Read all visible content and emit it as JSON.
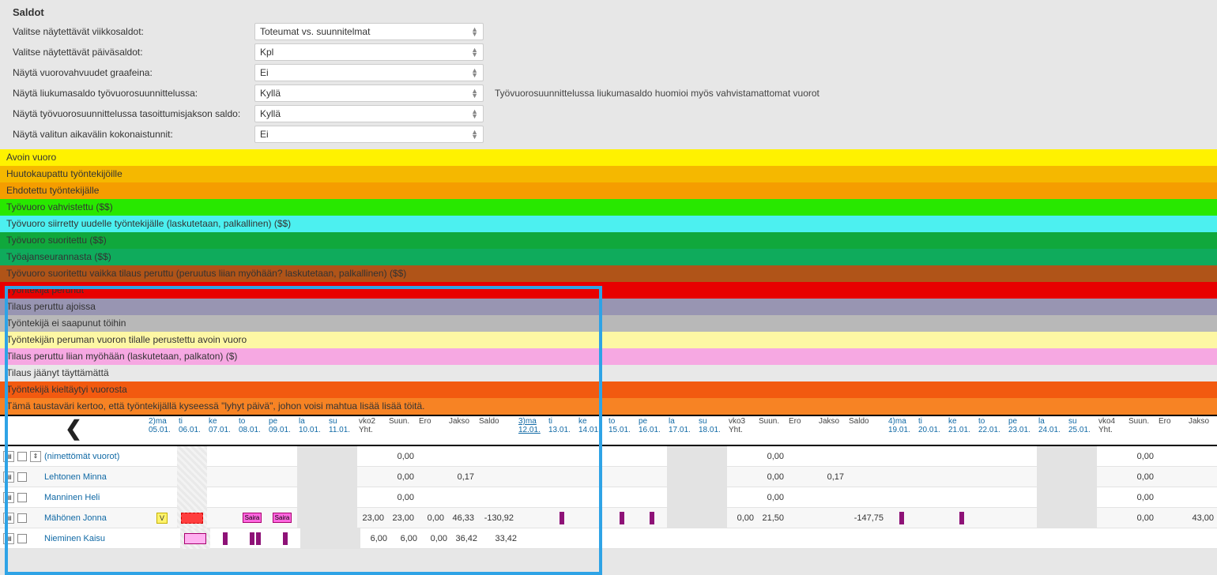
{
  "settings": {
    "title": "Saldot",
    "rows": [
      {
        "label": "Valitse näytettävät viikkosaldot:",
        "value": "Toteumat vs. suunnitelmat",
        "note": ""
      },
      {
        "label": "Valitse näytettävät päiväsaldot:",
        "value": "Kpl",
        "note": ""
      },
      {
        "label": "Näytä vuorovahvuudet graafeina:",
        "value": "Ei",
        "note": ""
      },
      {
        "label": "Näytä liukumasaldo työvuorosuunnittelussa:",
        "value": "Kyllä",
        "note": "Työvuorosuunnittelussa liukumasaldo huomioi myös vahvistamattomat vuorot"
      },
      {
        "label": "Näytä työvuorosuunnittelussa tasoittumisjakson saldo:",
        "value": "Kyllä",
        "note": ""
      },
      {
        "label": "Näytä valitun aikavälin kokonaistunnit:",
        "value": "Ei",
        "note": ""
      }
    ]
  },
  "legend": [
    {
      "cls": "c-yellow",
      "text": "Avoin vuoro"
    },
    {
      "cls": "c-orange1",
      "text": "Huutokaupattu työntekijöille"
    },
    {
      "cls": "c-orange2",
      "text": "Ehdotettu työntekijälle"
    },
    {
      "cls": "c-green-br",
      "text": "Työvuoro vahvistettu ($$)"
    },
    {
      "cls": "c-cyan",
      "text": "Työvuoro siirretty uudelle työntekijälle (laskutetaan, palkallinen) ($$)"
    },
    {
      "cls": "c-green-med",
      "text": "Työvuoro suoritettu ($$)"
    },
    {
      "cls": "c-green-em",
      "text": "Työajanseurannasta ($$)"
    },
    {
      "cls": "c-brown",
      "text": "Työvuoro suoritettu vaikka tilaus peruttu (peruutus liian myöhään? laskutetaan, palkallinen) ($$)"
    },
    {
      "cls": "c-red",
      "text": "Työntekijä perunut"
    },
    {
      "cls": "c-purple-gr",
      "text": "Tilaus peruttu ajoissa"
    },
    {
      "cls": "c-grey",
      "text": "Työntekijä ei saapunut töihin"
    },
    {
      "cls": "c-pale-yel",
      "text": "Työntekijän peruman vuoron tilalle perustettu avoin vuoro"
    },
    {
      "cls": "c-pink",
      "text": "Tilaus peruttu liian myöhään (laskutetaan, palkaton) ($)"
    },
    {
      "cls": "c-lightgrey",
      "text": "Tilaus jäänyt täyttämättä"
    },
    {
      "cls": "c-orange-br",
      "text": "Työntekijä kieltäytyi vuorosta"
    },
    {
      "cls": "c-orange-br2",
      "text": "Tämä taustaväri kertoo, että työntekijällä kyseessä \"lyhyt päivä\", johon voisi mahtua lisää lisää töitä."
    }
  ],
  "header": {
    "wk2_days": [
      {
        "d": "2)ma",
        "dt": "05.01."
      },
      {
        "d": "ti",
        "dt": "06.01."
      },
      {
        "d": "ke",
        "dt": "07.01."
      },
      {
        "d": "to",
        "dt": "08.01."
      },
      {
        "d": "pe",
        "dt": "09.01."
      },
      {
        "d": "la",
        "dt": "10.01."
      },
      {
        "d": "su",
        "dt": "11.01."
      }
    ],
    "wk2_sum": [
      "vko2",
      "Suun.",
      "Ero",
      "Jakso",
      "Saldo"
    ],
    "wk3_days": [
      {
        "d": "3)ma",
        "dt": "12.01.",
        "u": true
      },
      {
        "d": "ti",
        "dt": "13.01."
      },
      {
        "d": "ke",
        "dt": "14.01."
      },
      {
        "d": "to",
        "dt": "15.01."
      },
      {
        "d": "pe",
        "dt": "16.01."
      },
      {
        "d": "la",
        "dt": "17.01."
      },
      {
        "d": "su",
        "dt": "18.01."
      }
    ],
    "wk3_sum": [
      "vko3",
      "Suun.",
      "Ero",
      "Jakso",
      "Saldo"
    ],
    "wk4_days": [
      {
        "d": "4)ma",
        "dt": "19.01."
      },
      {
        "d": "ti",
        "dt": "20.01."
      },
      {
        "d": "ke",
        "dt": "21.01."
      },
      {
        "d": "to",
        "dt": "22.01."
      },
      {
        "d": "pe",
        "dt": "23.01."
      },
      {
        "d": "la",
        "dt": "24.01."
      },
      {
        "d": "su",
        "dt": "25.01."
      }
    ],
    "wk4_sum": [
      "vko4",
      "Suun.",
      "Ero",
      "Jakso"
    ],
    "yht": "Yht."
  },
  "rows": {
    "unnamed": {
      "label": "(nimettömät vuorot)",
      "w2": "0,00",
      "w3": "0,00",
      "w4": "0,00"
    },
    "lehtonen": {
      "label": "Lehtonen Minna",
      "w2": "0,00",
      "w2b": "0,17",
      "w3": "0,00",
      "w3b": "0,17",
      "w4": "0,00"
    },
    "manninen": {
      "label": "Manninen Heli",
      "w2": "0,00",
      "w3": "0,00",
      "w4": "0,00"
    },
    "mahonen": {
      "label": "Mähönen Jonna",
      "saira": "Saira",
      "s2": [
        "23,00",
        "23,00",
        "0,00",
        "46,33",
        "-130,92"
      ],
      "s3": [
        "0,00",
        "21,50",
        "-147,75"
      ],
      "s4": [
        "0,00",
        "43,00"
      ]
    },
    "nieminen": {
      "label": "Nieminen Kaisu",
      "s2": [
        "6,00",
        "6,00",
        "0,00",
        "36,42",
        "33,42"
      ]
    }
  },
  "icons": {
    "expand": "⇕"
  }
}
